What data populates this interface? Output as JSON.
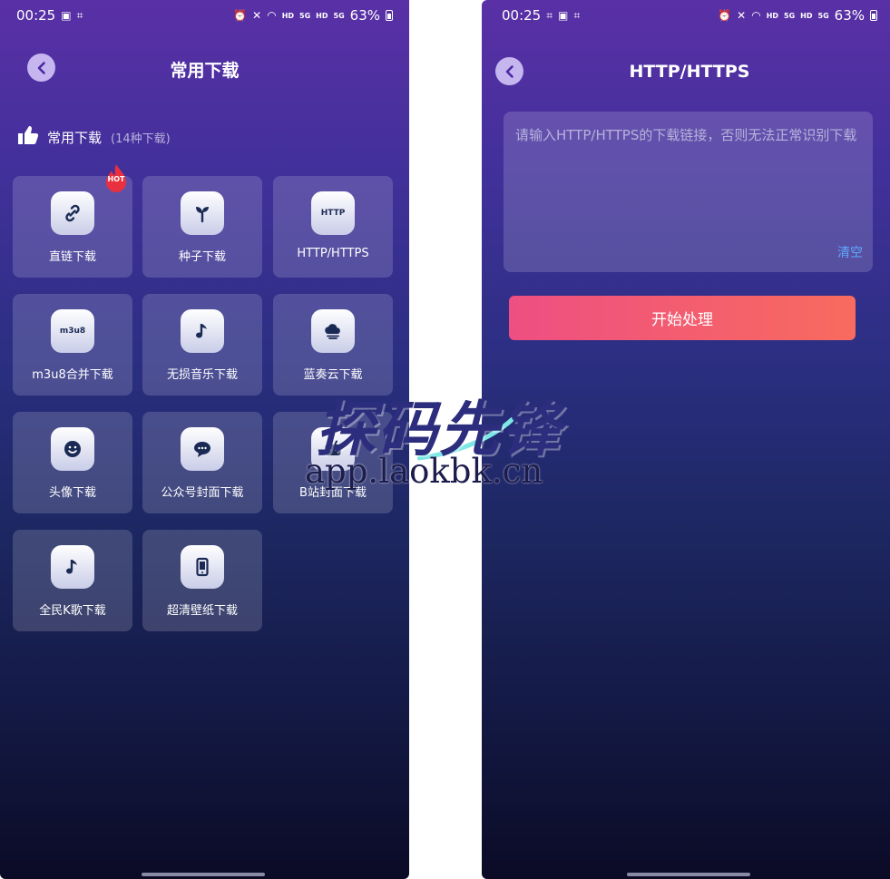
{
  "left_screen": {
    "status": {
      "time": "00:25",
      "battery": "63%",
      "net1": "HD",
      "net2": "5G",
      "net3": "HD",
      "net4": "5G"
    },
    "title": "常用下载",
    "section": {
      "title": "常用下载",
      "count": "(14种下载)"
    },
    "hot_badge": "HOT",
    "tiles": [
      {
        "label": "直链下载",
        "icon": "link-icon"
      },
      {
        "label": "种子下载",
        "icon": "sprout-icon"
      },
      {
        "label": "HTTP/HTTPS",
        "icon": "http-icon",
        "icon_text": "HTTP"
      },
      {
        "label": "m3u8合并下载",
        "icon": "m3u8-icon",
        "icon_text": "m3u8"
      },
      {
        "label": "无损音乐下载",
        "icon": "music-note-icon"
      },
      {
        "label": "蓝奏云下载",
        "icon": "cloud-icon"
      },
      {
        "label": "头像下载",
        "icon": "smiley-icon"
      },
      {
        "label": "公众号封面下载",
        "icon": "chat-bubble-icon"
      },
      {
        "label": "B站封面下载",
        "icon": "bilibili-icon"
      },
      {
        "label": "全民K歌下载",
        "icon": "music-note-icon"
      },
      {
        "label": "超清壁纸下载",
        "icon": "phone-icon"
      }
    ]
  },
  "right_screen": {
    "status": {
      "time": "00:25",
      "battery": "63%",
      "net1": "HD",
      "net2": "5G",
      "net3": "HD",
      "net4": "5G"
    },
    "title": "HTTP/HTTPS",
    "input_placeholder": "请输入HTTP/HTTPS的下载链接，否则无法正常识别下载",
    "clear_label": "清空",
    "start_label": "开始处理"
  },
  "watermark": {
    "logo": "探码先锋",
    "url": "app.laokbk.cn"
  },
  "colors": {
    "accent_button": "#f0587a",
    "link": "#5ea9ff",
    "bg_top": "#5a30a6",
    "bg_bottom": "#0b0b26"
  }
}
